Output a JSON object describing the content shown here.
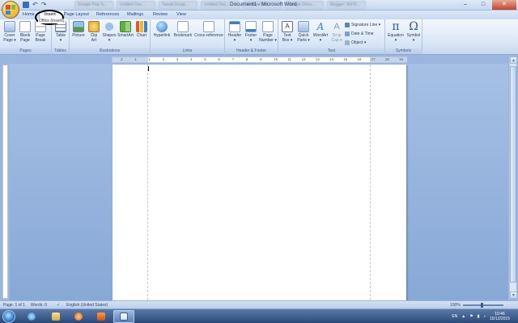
{
  "window": {
    "title": "Document1 - Microsoft Word",
    "minimize": "–",
    "maximize": "□",
    "close": "✕",
    "background_tabs": [
      "Google Play S...",
      "Untitled Doc...",
      "Tweak Email...",
      "Untitled Doc...",
      "Untitled Doc...",
      "Google Drive...",
      "Blogger: Wd B..."
    ]
  },
  "ribbon_tabs": [
    "Home",
    "Insert",
    "Page Layout",
    "References",
    "Mailings",
    "Review",
    "View"
  ],
  "annotation": {
    "tooltip": "Office (InsertI)"
  },
  "groups": {
    "pages": {
      "label": "Pages",
      "cover_page": "Cover\nPage ▾",
      "blank_page": "Blank\nPage",
      "page_break": "Page\nBreak"
    },
    "tables": {
      "label": "Tables",
      "table": "Table\n▾"
    },
    "illustrations": {
      "label": "Illustrations",
      "picture": "Picture",
      "clip_art": "Clip\nArt",
      "shapes": "Shapes\n▾",
      "smartart": "SmartArt",
      "chart": "Chart"
    },
    "links": {
      "label": "Links",
      "hyperlink": "Hyperlink",
      "bookmark": "Bookmark",
      "cross_reference": "Cross-reference"
    },
    "header_footer": {
      "label": "Header & Footer",
      "header": "Header\n▾",
      "footer": "Footer\n▾",
      "page_number": "Page\nNumber ▾"
    },
    "text": {
      "label": "Text",
      "text_box": "Text\nBox ▾",
      "quick_parts": "Quick\nParts ▾",
      "wordart": "WordArt\n▾",
      "drop_cap": "Drop\nCap ▾",
      "signature_line": "Signature Line ▾",
      "date_time": "Date & Time",
      "object": "Object ▾"
    },
    "symbols": {
      "label": "Symbols",
      "equation": "Equation\n▾",
      "symbol": "Symbol\n▾"
    }
  },
  "ruler": {
    "numbers": [
      "2",
      "1",
      "1",
      "2",
      "3",
      "4",
      "5",
      "6",
      "7",
      "8",
      "9",
      "10",
      "11",
      "12",
      "13",
      "14",
      "15",
      "16",
      "17",
      "18",
      "19"
    ]
  },
  "statusbar": {
    "page": "Page: 1 of 1",
    "words": "Words: 0",
    "language": "English (United States)",
    "zoom": "100%"
  },
  "taskbar": {
    "language": "EN",
    "time": "10:46",
    "date": "15/12/2015"
  }
}
